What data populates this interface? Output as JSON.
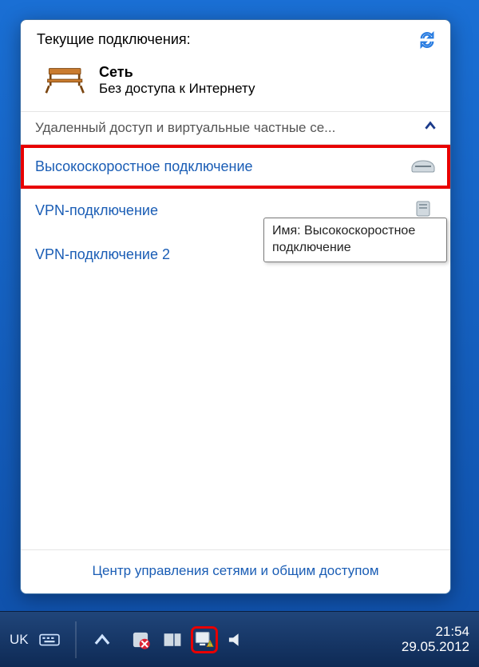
{
  "popup": {
    "title": "Текущие подключения:",
    "network": {
      "name": "Сеть",
      "status": "Без доступа к Интернету"
    },
    "section_header": "Удаленный доступ и виртуальные частные се...",
    "connections": [
      {
        "label": "Высокоскоростное подключение"
      },
      {
        "label": "VPN-подключение"
      },
      {
        "label": "VPN-подключение 2"
      }
    ],
    "tooltip": "Имя: Высокоскоростное подключение",
    "footer_link": "Центр управления сетями и общим доступом"
  },
  "taskbar": {
    "language": "UK",
    "time": "21:54",
    "date": "29.05.2012"
  }
}
